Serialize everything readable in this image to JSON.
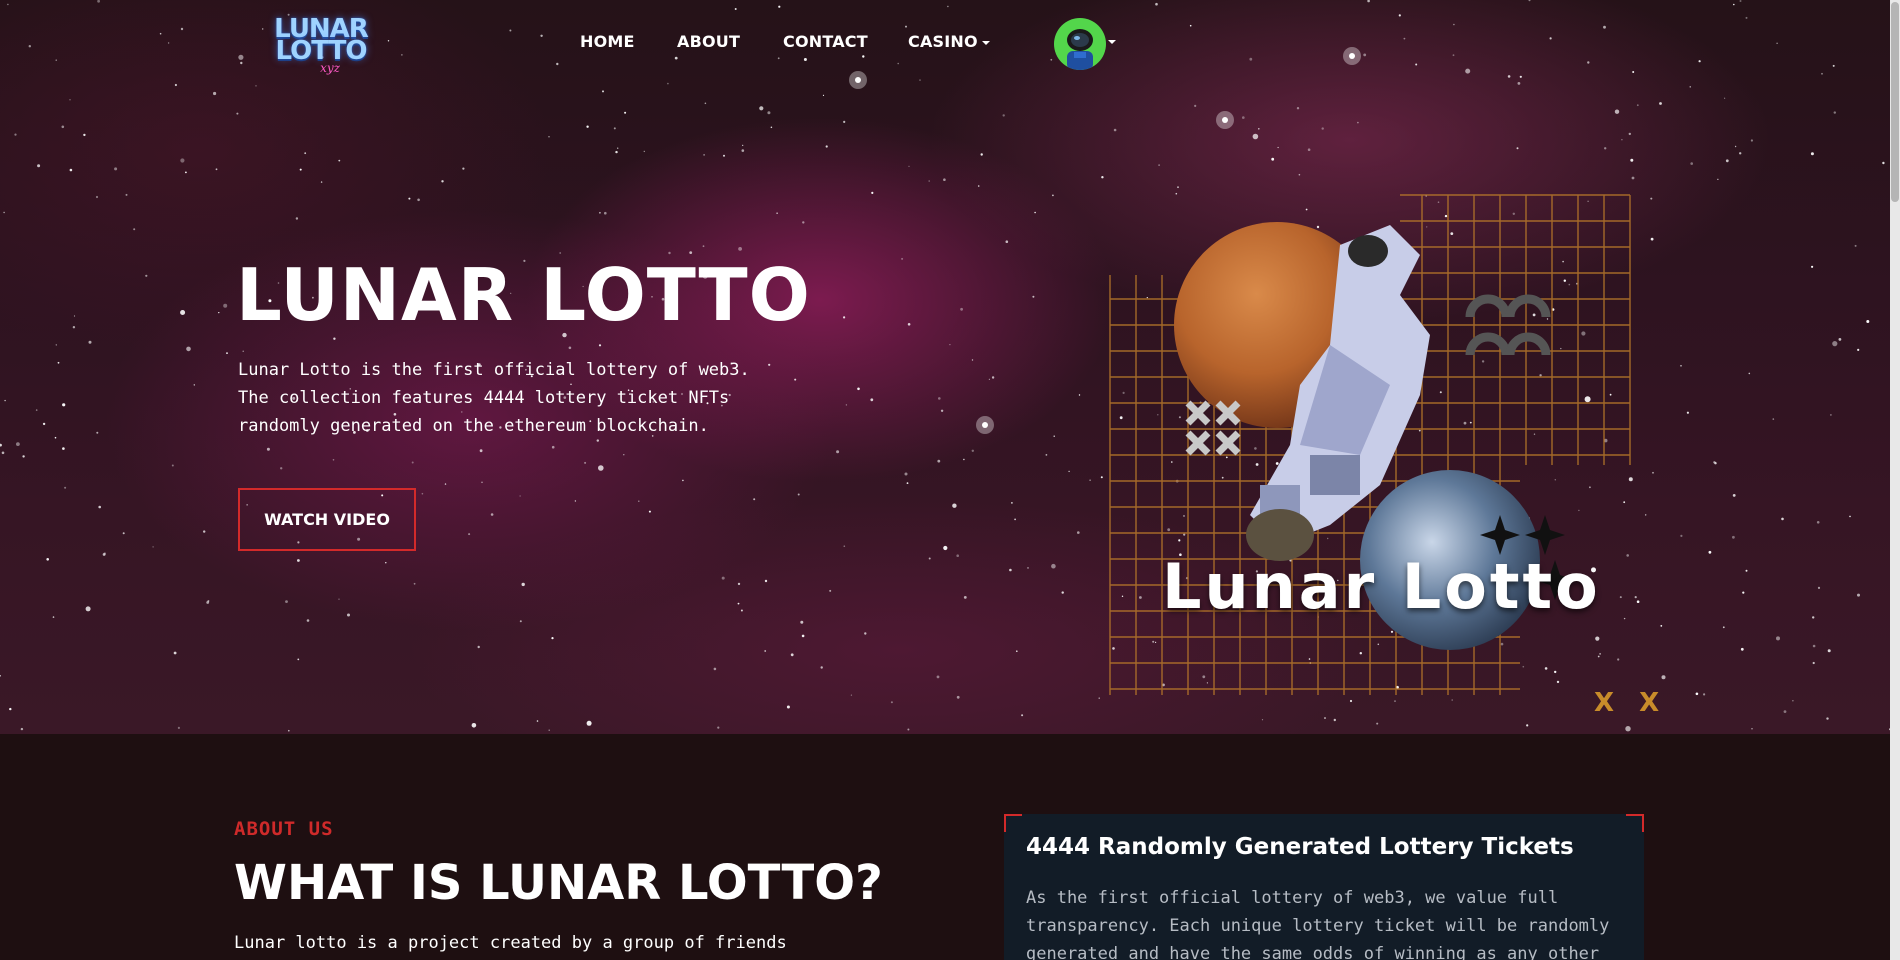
{
  "header": {
    "logo": {
      "line1": "LUNAR",
      "line2": "LOTTO",
      "suffix": "xyz"
    },
    "nav": [
      {
        "label": "HOME"
      },
      {
        "label": "ABOUT"
      },
      {
        "label": "CONTACT"
      },
      {
        "label": "CASINO",
        "has_dropdown": true
      }
    ],
    "account_icon": "astronaut-avatar-icon"
  },
  "hero": {
    "title": "LUNAR LOTTO",
    "description_lines": [
      "Lunar Lotto is the first official lottery of web3.",
      "The collection features 4444 lottery ticket NFTs",
      "randomly generated on the ethereum blockchain."
    ],
    "cta_label": "WATCH VIDEO",
    "art_caption": "Lunar Lotto",
    "art_marks": "X X"
  },
  "about": {
    "eyebrow": "ABOUT US",
    "title": "WHAT IS LUNAR LOTTO?",
    "text_line1": "Lunar lotto is a project created by a group of friends",
    "card": {
      "title": "4444 Randomly Generated Lottery Tickets",
      "text_lines": [
        "As the first official lottery of web3, we value full",
        "transparency. Each unique lottery ticket will be randomly",
        "generated and have the same odds of winning as any other"
      ]
    }
  },
  "colors": {
    "accent_red": "#d32a2a",
    "avatar_green": "#53d64b",
    "grid_gold": "#b8782a",
    "card_bg": "#121c27"
  }
}
